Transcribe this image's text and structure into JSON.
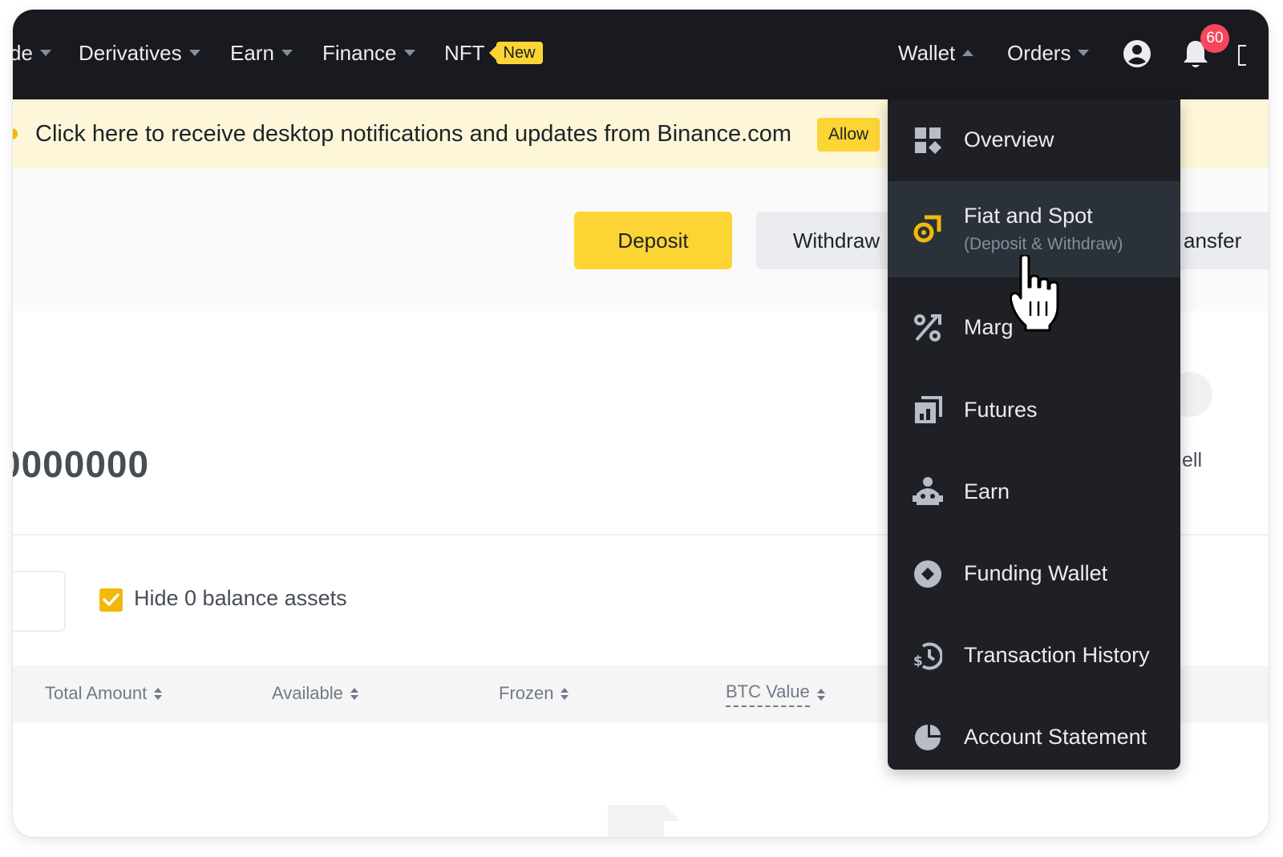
{
  "nav": {
    "items": [
      {
        "label": "de",
        "caret": "down"
      },
      {
        "label": "Derivatives",
        "caret": "down"
      },
      {
        "label": "Earn",
        "caret": "down"
      },
      {
        "label": "Finance",
        "caret": "down"
      },
      {
        "label": "NFT",
        "badge": "New"
      }
    ],
    "right": {
      "wallet_label": "Wallet",
      "orders_label": "Orders",
      "profile_icon": "user-circle-icon",
      "notification_icon": "bell-icon",
      "notification_count": "60"
    }
  },
  "banner": {
    "text": "Click here to receive desktop notifications and updates from Binance.com",
    "allow_label": "Allow"
  },
  "actions": {
    "deposit_label": "Deposit",
    "withdraw_label": "Withdraw",
    "transfer_label": "ansfer"
  },
  "balance": {
    "value": "0000000",
    "side_label": "ell"
  },
  "filters": {
    "hide_zero_label": "Hide 0 balance assets",
    "hide_zero_checked": true
  },
  "table": {
    "columns": [
      "Total Amount",
      "Available",
      "Frozen",
      "BTC Value"
    ]
  },
  "wallet_menu": {
    "items": [
      {
        "label": "Overview",
        "icon": "dashboard-grid-icon"
      },
      {
        "label": "Fiat and Spot",
        "sub": "(Deposit & Withdraw)",
        "icon": "fiat-spot-icon",
        "active": true
      },
      {
        "label": "Marg",
        "icon": "margin-percent-icon"
      },
      {
        "label": "Futures",
        "icon": "futures-icon"
      },
      {
        "label": "Earn",
        "icon": "earn-robot-icon"
      },
      {
        "label": "Funding Wallet",
        "icon": "funding-diamond-icon"
      },
      {
        "label": "Transaction History",
        "icon": "history-dollar-icon"
      },
      {
        "label": "Account Statement",
        "icon": "pie-statement-icon"
      }
    ]
  },
  "colors": {
    "nav_bg": "#181a20",
    "accent_yellow": "#fcd535",
    "banner_bg": "#fef6d8",
    "menu_bg": "#1e2026",
    "menu_active_bg": "#2b3139",
    "notification_red": "#f6465d"
  }
}
